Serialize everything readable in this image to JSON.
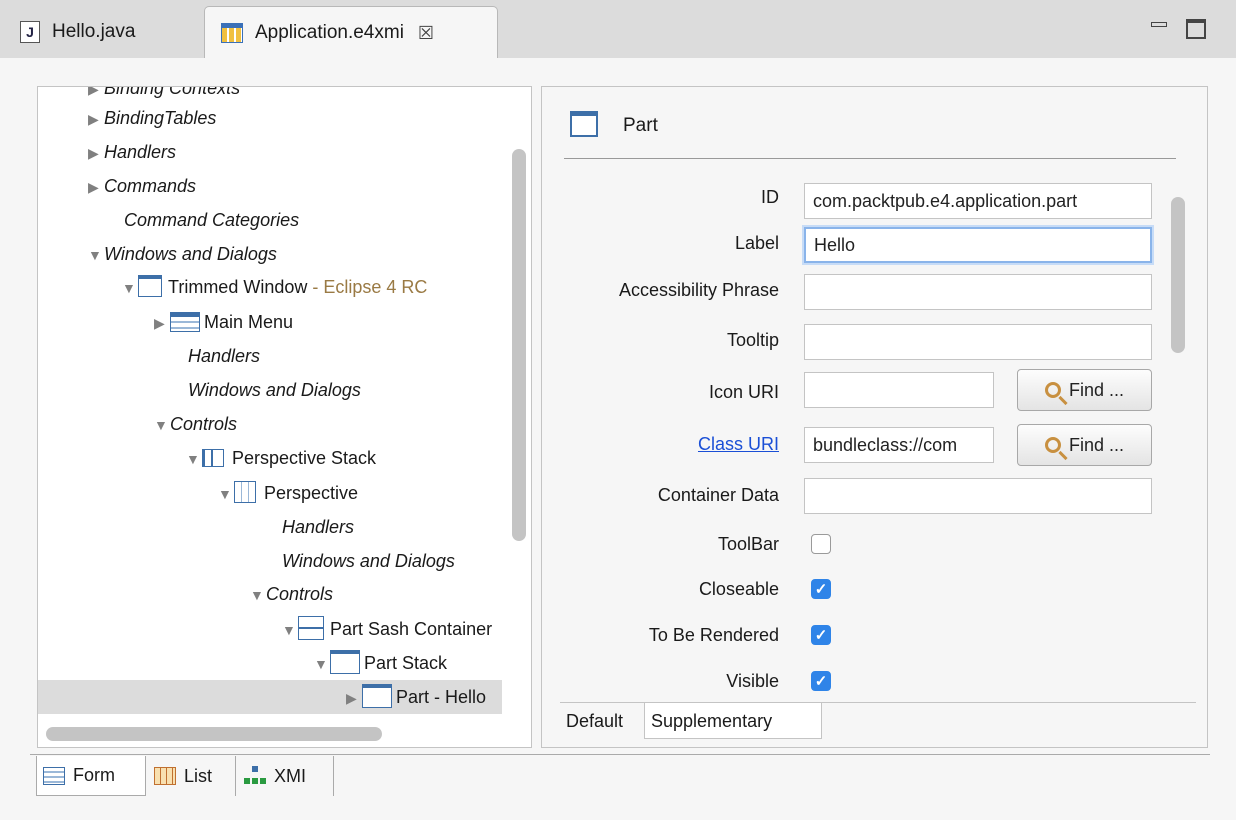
{
  "tabs": [
    {
      "label": "Hello.java",
      "icon": "java-file-icon",
      "active": false
    },
    {
      "label": "Application.e4xmi",
      "icon": "e4xmi-file-icon",
      "active": true,
      "close_glyph": "☒"
    }
  ],
  "tree": {
    "rows": [
      {
        "label": "Binding Contexts",
        "italic": true,
        "arrow": "▶",
        "icon": null,
        "suffix": ""
      },
      {
        "label": "BindingTables",
        "italic": true,
        "arrow": "▶",
        "icon": null,
        "suffix": ""
      },
      {
        "label": "Handlers",
        "italic": true,
        "arrow": "▶",
        "icon": null,
        "suffix": ""
      },
      {
        "label": "Commands",
        "italic": true,
        "arrow": "▶",
        "icon": null,
        "suffix": ""
      },
      {
        "label": "Command Categories",
        "italic": true,
        "arrow": "",
        "icon": null,
        "suffix": ""
      },
      {
        "label": "Windows and Dialogs",
        "italic": true,
        "arrow": "▼",
        "icon": null,
        "suffix": ""
      },
      {
        "label": "Trimmed Window",
        "italic": false,
        "arrow": "▼",
        "icon": "window-icon",
        "suffix": " - Eclipse 4 RC"
      },
      {
        "label": "Main Menu",
        "italic": false,
        "arrow": "▶",
        "icon": "menu-icon",
        "suffix": ""
      },
      {
        "label": "Handlers",
        "italic": true,
        "arrow": "",
        "icon": null,
        "suffix": ""
      },
      {
        "label": "Windows and Dialogs",
        "italic": true,
        "arrow": "",
        "icon": null,
        "suffix": ""
      },
      {
        "label": "Controls",
        "italic": true,
        "arrow": "▼",
        "icon": null,
        "suffix": ""
      },
      {
        "label": "Perspective Stack",
        "italic": false,
        "arrow": "▼",
        "icon": "perspective-stack-icon",
        "suffix": ""
      },
      {
        "label": "Perspective",
        "italic": false,
        "arrow": "▼",
        "icon": "perspective-icon",
        "suffix": ""
      },
      {
        "label": "Handlers",
        "italic": true,
        "arrow": "",
        "icon": null,
        "suffix": ""
      },
      {
        "label": "Windows and Dialogs",
        "italic": true,
        "arrow": "",
        "icon": null,
        "suffix": ""
      },
      {
        "label": "Controls",
        "italic": true,
        "arrow": "▼",
        "icon": null,
        "suffix": ""
      },
      {
        "label": "Part Sash Container",
        "italic": false,
        "arrow": "▼",
        "icon": "sash-container-icon",
        "suffix": ""
      },
      {
        "label": "Part Stack",
        "italic": false,
        "arrow": "▼",
        "icon": "part-stack-icon",
        "suffix": ""
      },
      {
        "label": "Part - Hello",
        "italic": false,
        "arrow": "▶",
        "icon": "part-icon",
        "suffix": "",
        "selected": true
      }
    ]
  },
  "detail": {
    "title": "Part",
    "fields": {
      "id": {
        "label": "ID",
        "value": "com.packtpub.e4.application.part"
      },
      "label": {
        "label": "Label",
        "value": "Hello"
      },
      "accessibility": {
        "label": "Accessibility Phrase",
        "value": ""
      },
      "tooltip": {
        "label": "Tooltip",
        "value": ""
      },
      "icon_uri": {
        "label": "Icon URI",
        "value": ""
      },
      "class_uri": {
        "label": "Class URI",
        "value": "bundleclass://com"
      },
      "container_data": {
        "label": "Container Data",
        "value": ""
      }
    },
    "find_label": "Find ...",
    "checks": {
      "toolbar": {
        "label": "ToolBar",
        "checked": false
      },
      "closeable": {
        "label": "Closeable",
        "checked": true
      },
      "rendered": {
        "label": "To Be Rendered",
        "checked": true
      },
      "visible": {
        "label": "Visible",
        "checked": true
      }
    },
    "tabs": {
      "default": "Default",
      "supplementary": "Supplementary"
    }
  },
  "bottom_tabs": {
    "form": "Form",
    "list": "List",
    "xmi": "XMI"
  },
  "colors": {
    "selection": "#dcdcdc",
    "link": "#1a4fd6",
    "check": "#2f84e8",
    "muted_suffix": "#9a7a44"
  }
}
